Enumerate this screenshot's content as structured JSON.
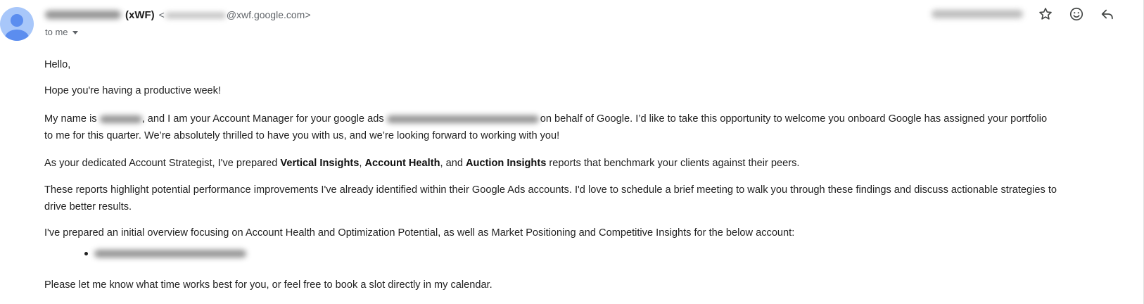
{
  "header": {
    "sender_tag": "(xWF)",
    "sender_email_domain": "@xwf.google.com>",
    "address_open": "<",
    "recipient_label": "to me"
  },
  "toolbar": {
    "icons": [
      "star-icon",
      "emoji-icon",
      "reply-icon"
    ]
  },
  "body": {
    "greeting": "Hello,",
    "hope": "Hope you're having a productive week!",
    "intro": {
      "part1": "My name is ",
      "part2": ", and I am your Account Manager for your google ads ",
      "part3": "on behalf of Google. I’d like to take this opportunity to welcome you onboard Google has assigned your portfolio",
      "part4": "to me for this quarter. We’re absolutely thrilled to have you with us, and we’re looking forward to working with you!"
    },
    "strategist": {
      "part1": "As your dedicated Account Strategist, I've prepared ",
      "bold1": "Vertical Insights",
      "sep1": ", ",
      "bold2": "Account Health",
      "sep2": ", and ",
      "bold3": "Auction Insights",
      "part2": " reports that benchmark your clients against their peers."
    },
    "reports": "These reports highlight potential performance improvements I've already identified within their Google Ads accounts. I'd love to schedule a brief meeting to walk you through these findings and discuss actionable strategies to drive better results.",
    "overview": "I've prepared an initial overview focusing on Account Health and Optimization Potential, as well as Market Positioning and Competitive Insights for the below account:",
    "closing": "Please let me know what time works best for you, or feel free to book a slot directly in my calendar."
  },
  "colors": {
    "avatar_bg": "#a8c7fa",
    "avatar_fg": "#5b8def",
    "text": "#222222",
    "muted": "#5f6368"
  }
}
